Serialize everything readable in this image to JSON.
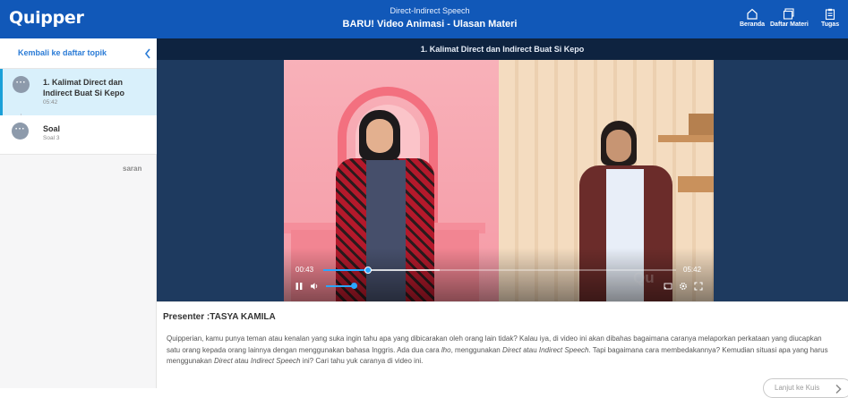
{
  "header": {
    "logo": "Quipper",
    "subtitle": "Direct-Indirect Speech",
    "title": "BARU! Video Animasi - Ulasan Materi",
    "nav": [
      {
        "label": "Beranda",
        "icon": "home-icon"
      },
      {
        "label": "Daftar Materi",
        "icon": "stack-icon"
      },
      {
        "label": "Tugas",
        "icon": "clipboard-icon"
      }
    ]
  },
  "sidebar": {
    "back_label": "Kembali ke daftar topik",
    "topics": [
      {
        "title": "1. Kalimat Direct dan Indirect Buat Si Kepo",
        "meta": "05:42",
        "active": true
      },
      {
        "title": "Soal",
        "meta": "Soal 3",
        "active": false
      }
    ],
    "saran": "saran"
  },
  "video": {
    "title": "1. Kalimat Direct dan Indirect Buat Si Kepo",
    "current_time": "00:43",
    "total_time": "05:42",
    "progress": 0.126,
    "buffered": 0.33,
    "volume": 0.9,
    "watermark": "Qu",
    "accent": "#2aa6ff"
  },
  "content": {
    "presenter": "Presenter :TASYA KAMILA",
    "desc_a": "Quipperian, kamu punya teman atau kenalan yang suka ingin tahu apa yang dibicarakan oleh orang lain tidak? Kalau iya, di video ini akan dibahas bagaimana caranya melaporkan perkataan yang diucapkan satu orang kepada orang lainnya dengan menggunakan bahasa Inggris. Ada dua cara ",
    "desc_i1": "lho",
    "desc_b": ", menggunakan ",
    "desc_i2": "Direct",
    "desc_c": " atau ",
    "desc_i3": "Indirect Speech",
    "desc_d": ". Tapi bagaimana cara membedakannya? Kemudian situasi apa yang harus menggunakan ",
    "desc_i4": "Direct",
    "desc_e": " atau ",
    "desc_i5": "Indirect Speech",
    "desc_f": " ini? Cari tahu yuk caranya di video ini.",
    "next_label": "Lanjut ke Kuis"
  },
  "colors": {
    "header_bg": "#1158b8",
    "active_topic_bg": "#d9f0fb",
    "link": "#2a7bd6"
  }
}
